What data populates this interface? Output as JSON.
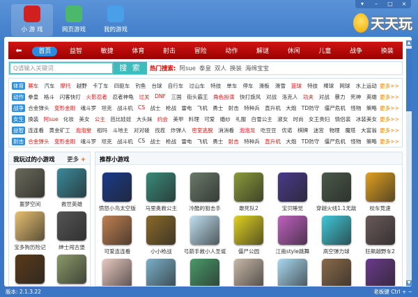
{
  "topnav": [
    {
      "label": "小 游 戏",
      "icon": "joystick-icon",
      "color": "#d02020"
    },
    {
      "label": "网页游戏",
      "icon": "webpage-icon",
      "color": "#4bb86a"
    },
    {
      "label": "我的游戏",
      "icon": "user-game-icon",
      "color": "#4aa0e8"
    }
  ],
  "window_buttons": [
    "▾",
    "–",
    "□",
    "×"
  ],
  "logo": "天天玩",
  "nav": {
    "back": "⬅",
    "items": [
      "首页",
      "益智",
      "敏捷",
      "体育",
      "射击",
      "冒险",
      "动作",
      "解谜",
      "休闲",
      "儿童",
      "战争",
      "换装"
    ]
  },
  "search": {
    "placeholder": "Q请输入关键词",
    "button": "搜 索",
    "hot_label": "热门搜索:",
    "hot": [
      "阿sue",
      "拳皇",
      "双人",
      "换装",
      "海绵宝宝"
    ]
  },
  "more_label": "更多>>",
  "categories": [
    {
      "label": "体育",
      "items": [
        [
          "赛车",
          1
        ],
        [
          "汽车",
          0
        ],
        [
          "摩托",
          1
        ],
        [
          "越野",
          0
        ],
        [
          "卡丁车",
          0
        ],
        [
          "四驱车",
          0
        ],
        [
          "钓鱼",
          0
        ],
        [
          "台球",
          0
        ],
        [
          "自行车",
          0
        ],
        [
          "过山车",
          0
        ],
        [
          "特技",
          0
        ],
        [
          "单车",
          0
        ],
        [
          "停车",
          0
        ],
        [
          "滑板",
          0
        ],
        [
          "滑雪",
          0
        ],
        [
          "篮球",
          1
        ],
        [
          "特技",
          0
        ],
        [
          "棒球",
          0
        ],
        [
          "网球",
          0
        ],
        [
          "水上运动",
          0
        ]
      ]
    },
    {
      "label": "动作",
      "items": [
        [
          "拳皇",
          0
        ],
        [
          "格斗",
          0
        ],
        [
          "闪客快打",
          0
        ],
        [
          "火影忍者",
          1
        ],
        [
          "忍者神龟",
          0
        ],
        [
          "过关",
          1
        ],
        [
          "DNF",
          1
        ],
        [
          "三国",
          0
        ],
        [
          "街头霸王",
          0
        ],
        [
          "角色扮演",
          1
        ],
        [
          "快打旋风",
          0
        ],
        [
          "对战",
          0
        ],
        [
          "洛克人",
          0
        ],
        [
          "功夫",
          1
        ],
        [
          "对战",
          0
        ],
        [
          "暴力",
          0
        ],
        [
          "死神",
          0
        ],
        [
          "英雄",
          0
        ]
      ]
    },
    {
      "label": "战争",
      "items": [
        [
          "合金弹头",
          0
        ],
        [
          "变形金刚",
          1
        ],
        [
          "魂斗罗",
          0
        ],
        [
          "坦克",
          0
        ],
        [
          "战斗机",
          0
        ],
        [
          "CS",
          1
        ],
        [
          "战士",
          0
        ],
        [
          "枪战",
          0
        ],
        [
          "雷电",
          0
        ],
        [
          "飞机",
          0
        ],
        [
          "勇士",
          0
        ],
        [
          "射击",
          0
        ],
        [
          "特种兵",
          0
        ],
        [
          "直升机",
          0
        ],
        [
          "大炮",
          0
        ],
        [
          "TD防守",
          0
        ],
        [
          "僵尸危机",
          0
        ],
        [
          "怪物",
          0
        ],
        [
          "策略",
          0
        ]
      ]
    },
    {
      "label": "女生",
      "items": [
        [
          "换装",
          0
        ],
        [
          "阿sue",
          1
        ],
        [
          "化妆",
          0
        ],
        [
          "美女",
          0
        ],
        [
          "公主",
          1
        ],
        [
          "芭比娃娃",
          0
        ],
        [
          "大头妹",
          0
        ],
        [
          "约会",
          1
        ],
        [
          "美甲",
          0
        ],
        [
          "料理",
          0
        ],
        [
          "可爱",
          0
        ],
        [
          "婚纱",
          0
        ],
        [
          "礼服",
          0
        ],
        [
          "白雪公主",
          0
        ],
        [
          "淑女",
          0
        ],
        [
          "时尚",
          0
        ],
        [
          "女王贵妇",
          0
        ],
        [
          "情侣装",
          0
        ],
        [
          "冰装美女",
          0
        ]
      ]
    },
    {
      "label": "益智",
      "items": [
        [
          "连连看",
          0
        ],
        [
          "黄金矿工",
          0
        ],
        [
          "泡泡堂",
          1
        ],
        [
          "祖玛",
          0
        ],
        [
          "斗地主",
          0
        ],
        [
          "对对碰",
          0
        ],
        [
          "找茬",
          0
        ],
        [
          "炸弹人",
          0
        ],
        [
          "密室逃脱",
          1
        ],
        [
          "消消看",
          0
        ],
        [
          "泡泡龙",
          1
        ],
        [
          "吃豆豆",
          0
        ],
        [
          "优诺",
          0
        ],
        [
          "棋牌",
          0
        ],
        [
          "迷宫",
          0
        ],
        [
          "物理",
          0
        ],
        [
          "魔塔",
          0
        ],
        [
          "大富翁",
          0
        ]
      ]
    },
    {
      "label": "射击",
      "items": [
        [
          "合金弹头",
          1
        ],
        [
          "变形金刚",
          1
        ],
        [
          "魂斗罗",
          0
        ],
        [
          "坦克",
          0
        ],
        [
          "战斗机",
          0
        ],
        [
          "CS",
          0
        ],
        [
          "战士",
          0
        ],
        [
          "枪战",
          0
        ],
        [
          "雷电",
          0
        ],
        [
          "飞机",
          0
        ],
        [
          "勇士",
          0
        ],
        [
          "射击",
          1
        ],
        [
          "特种兵",
          0
        ],
        [
          "直升机",
          1
        ],
        [
          "大炮",
          0
        ],
        [
          "TD防守",
          0
        ],
        [
          "僵尸危机",
          0
        ],
        [
          "怪物",
          0
        ],
        [
          "策略",
          0
        ]
      ]
    }
  ],
  "played": {
    "title": "我玩过的小游戏",
    "more": "更多",
    "plus": "+",
    "games": [
      {
        "name": "噩梦空间",
        "color": "#6a6a5a"
      },
      {
        "name": "救世英雄",
        "color": "#3a8a9a"
      },
      {
        "name": "宝多狗历险记",
        "color": "#e8c070"
      },
      {
        "name": "绅士闯古堡",
        "color": "#555555"
      },
      {
        "name": "",
        "color": "#5a3a1a"
      },
      {
        "name": "",
        "color": "#8a9a6a"
      }
    ]
  },
  "recommended": {
    "title": "推荐小游戏",
    "games": [
      {
        "name": "愤怒小鸟太空版",
        "color": "#1a3a8a"
      },
      {
        "name": "马里奥救公主",
        "color": "#3a8a7a"
      },
      {
        "name": "冷酷的狙击手",
        "color": "#6a7a6a"
      },
      {
        "name": "敢死队2",
        "color": "#8a9a3a"
      },
      {
        "name": "宝贝睡觉",
        "color": "#4a3a8a"
      },
      {
        "name": "穿越火线1.1无敌",
        "color": "#4a5a4a"
      },
      {
        "name": "校车竞速",
        "color": "#e0a020"
      },
      {
        "name": "可爱连连看",
        "color": "#c08050"
      },
      {
        "name": "小小枪战",
        "color": "#8a6a2a"
      },
      {
        "name": "弓箭手救小人圣诞",
        "color": "#bfe0f0"
      },
      {
        "name": "僵尸公园",
        "color": "#e0d020"
      },
      {
        "name": "江南style跳舞",
        "color": "#c060c0"
      },
      {
        "name": "高空弹力球",
        "color": "#40c8d8"
      },
      {
        "name": "狂飙越野车2",
        "color": "#6a5a5a"
      },
      {
        "name": "",
        "color": "#e8c8c0"
      },
      {
        "name": "",
        "color": "#7ab0c8"
      },
      {
        "name": "",
        "color": "#4a9a6a"
      },
      {
        "name": "",
        "color": "#c8b8a8"
      },
      {
        "name": "",
        "color": "#a8d8f0"
      },
      {
        "name": "",
        "color": "#8a6a4a"
      },
      {
        "name": "",
        "color": "#6a3a8a"
      }
    ]
  },
  "status": {
    "version": "版本: 2.1.3.22",
    "boss_key": "老板键 Ctrl + ~"
  }
}
